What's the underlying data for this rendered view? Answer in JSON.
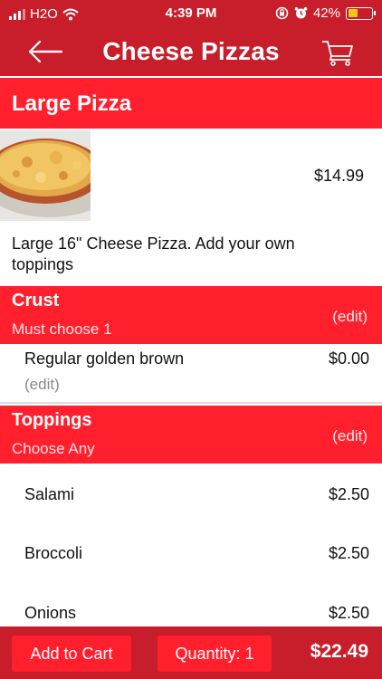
{
  "status_bar": {
    "carrier": "H2O",
    "time": "4:39 PM",
    "battery": "42%",
    "battery_level": 0.42
  },
  "nav": {
    "title": "Cheese Pizzas",
    "back_icon": "back-arrow-icon",
    "cart_icon": "cart-icon"
  },
  "product": {
    "title": "Large Pizza",
    "price": "$14.99",
    "description": "Large 16\" Cheese Pizza. Add your own toppings",
    "image": "pizza-photo"
  },
  "crust": {
    "title": "Crust",
    "subtitle": "Must choose 1",
    "edit_label": "(edit)",
    "selected": {
      "label": "Regular golden brown",
      "price": "$0.00",
      "edit_label": "(edit)"
    }
  },
  "toppings": {
    "title": "Toppings",
    "subtitle": "Choose Any",
    "edit_label": "(edit)",
    "items": [
      {
        "label": "Salami",
        "price": "$2.50"
      },
      {
        "label": "Broccoli",
        "price": "$2.50"
      },
      {
        "label": "Onions",
        "price": "$2.50"
      }
    ]
  },
  "footer": {
    "add_to_cart_label": "Add to Cart",
    "quantity_label": "Quantity: 1",
    "total": "$22.49"
  },
  "colors": {
    "bar_red": "#c81e2b",
    "header_red": "#ff1f2d",
    "battery_yellow": "#f6c419"
  }
}
